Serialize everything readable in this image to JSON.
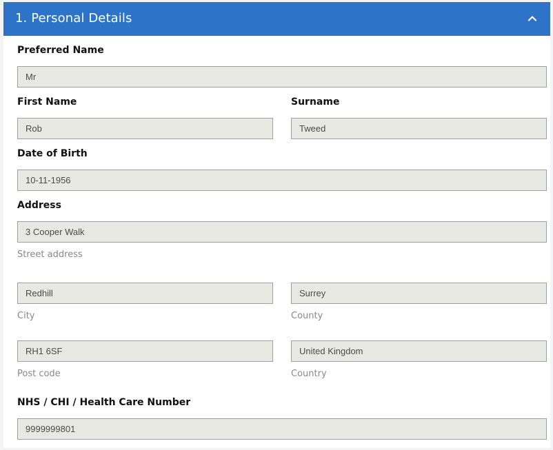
{
  "section": {
    "title": "1. Personal Details",
    "toggle_icon": "chevron-up-icon",
    "header_color": "#2d74c8"
  },
  "fields": {
    "preferred_name": {
      "label": "Preferred Name",
      "value": "Mr"
    },
    "first_name": {
      "label": "First Name",
      "value": "Rob"
    },
    "surname": {
      "label": "Surname",
      "value": "Tweed"
    },
    "date_of_birth": {
      "label": "Date of Birth",
      "value": "10-11-1956"
    },
    "address": {
      "label": "Address",
      "street": {
        "value": "3 Cooper Walk",
        "hint": "Street address"
      },
      "city": {
        "value": "Redhill",
        "hint": "City"
      },
      "county": {
        "value": "Surrey",
        "hint": "County"
      },
      "post_code": {
        "value": "RH1 6SF",
        "hint": "Post code"
      },
      "country": {
        "value": "United Kingdom",
        "hint": "Country"
      }
    },
    "health_number": {
      "label": "NHS / CHI / Health Care Number",
      "value": "9999999801"
    }
  }
}
